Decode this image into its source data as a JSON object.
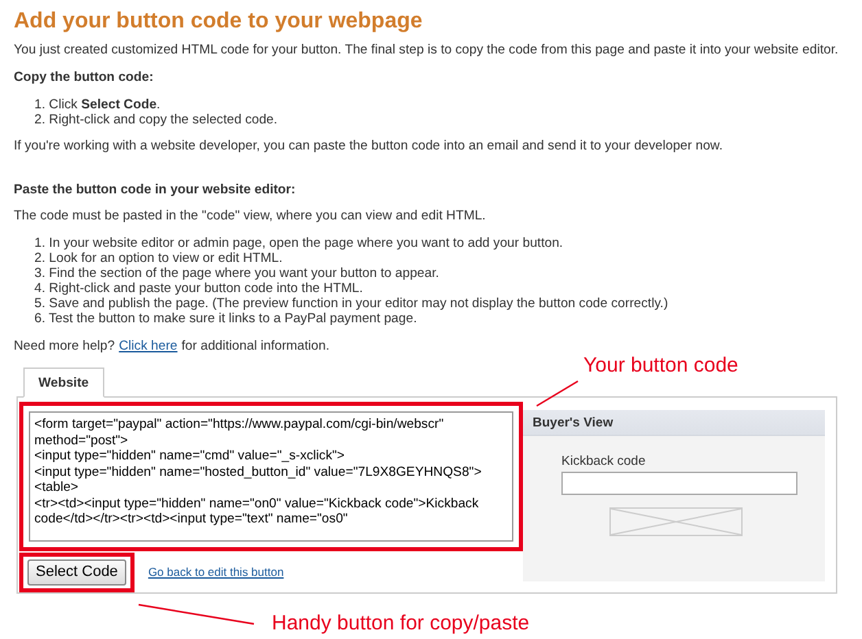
{
  "heading": "Add your button code to your webpage",
  "intro": "You just created customized HTML code for your button. The final step is to copy the code from this page and paste it into your website editor.",
  "copy_section": {
    "title": "Copy the button code:",
    "steps": [
      "1. Click **Select Code**.",
      "2. Right-click and copy the selected code."
    ]
  },
  "developer_note": "If you're working with a website developer, you can paste the button code into an email and send it to your developer now.",
  "paste_section": {
    "title": "Paste the button code in your website editor:",
    "note": "The code must be pasted in the \"code\" view, where you can view and edit HTML.",
    "steps": [
      "1. In your website editor or admin page, open the page where you want to add your button.",
      "2. Look for an option to view or edit HTML.",
      "3. Find the section of the page where you want your button to appear.",
      "4. Right-click and paste your button code into the HTML.",
      "5. Save and publish the page. (The preview function in your editor may not display the button code correctly.)",
      "6. Test the button to make sure it links to a PayPal payment page."
    ]
  },
  "help": {
    "before": "Need more help?",
    "link": "Click here",
    "after": "for additional information."
  },
  "tabs": [
    {
      "label": "Website",
      "selected": true
    }
  ],
  "code": "<form target=\"paypal\" action=\"https://www.paypal.com/cgi-bin/webscr\" method=\"post\">\n<input type=\"hidden\" name=\"cmd\" value=\"_s-xclick\">\n<input type=\"hidden\" name=\"hosted_button_id\" value=\"7L9X8GEYHNQS8\">\n<table>\n<tr><td><input type=\"hidden\" name=\"on0\" value=\"Kickback code\">Kickback code</td></tr><tr><td><input type=\"text\" name=\"os0\"",
  "select_button": "Select Code",
  "back_link": "Go back to edit this button",
  "buyers_view": {
    "title": "Buyer's View",
    "field_label": "Kickback code"
  },
  "annotations": [
    {
      "text": "Your button code"
    },
    {
      "text": "Handy button for copy/paste"
    }
  ]
}
